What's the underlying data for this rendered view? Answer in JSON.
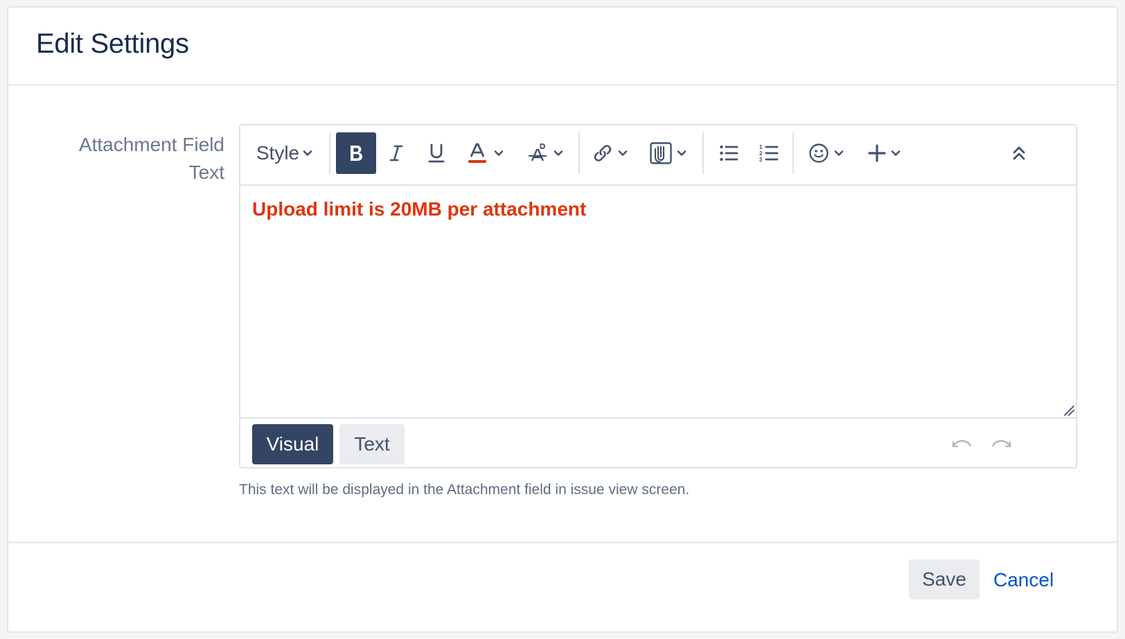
{
  "dialog": {
    "title": "Edit Settings"
  },
  "field": {
    "label_line1": "Attachment Field",
    "label_line2": "Text",
    "help_text": "This text will be displayed in the Attachment field in issue view screen."
  },
  "toolbar": {
    "style_label": "Style",
    "bold_label": "B",
    "items": [
      {
        "name": "bold",
        "icon": "bold-icon",
        "active": true
      },
      {
        "name": "italic",
        "icon": "italic-icon"
      },
      {
        "name": "underline",
        "icon": "underline-icon"
      },
      {
        "name": "text-color",
        "icon": "text-color-icon",
        "dropdown": true
      },
      {
        "name": "more-formatting",
        "icon": "clear-formatting-icon",
        "dropdown": true
      },
      {
        "name": "link",
        "icon": "link-icon",
        "dropdown": true
      },
      {
        "name": "attachment",
        "icon": "attachment-icon",
        "dropdown": true
      },
      {
        "name": "bullet-list",
        "icon": "bullet-list-icon"
      },
      {
        "name": "numbered-list",
        "icon": "numbered-list-icon"
      },
      {
        "name": "emoticon",
        "icon": "emoticon-icon",
        "dropdown": true
      },
      {
        "name": "insert-more",
        "icon": "plus-icon",
        "dropdown": true
      },
      {
        "name": "collapse",
        "icon": "collapse-toolbar-icon"
      }
    ]
  },
  "editor": {
    "content": "Upload limit is 20MB per attachment",
    "content_color": "#de350b",
    "modes": {
      "visual_label": "Visual",
      "text_label": "Text",
      "active": "visual"
    }
  },
  "footer": {
    "save_label": "Save",
    "cancel_label": "Cancel"
  },
  "colors": {
    "primary_dark": "#344563",
    "link_blue": "#0052cc",
    "text_red": "#de350b",
    "muted": "#6b778c"
  }
}
